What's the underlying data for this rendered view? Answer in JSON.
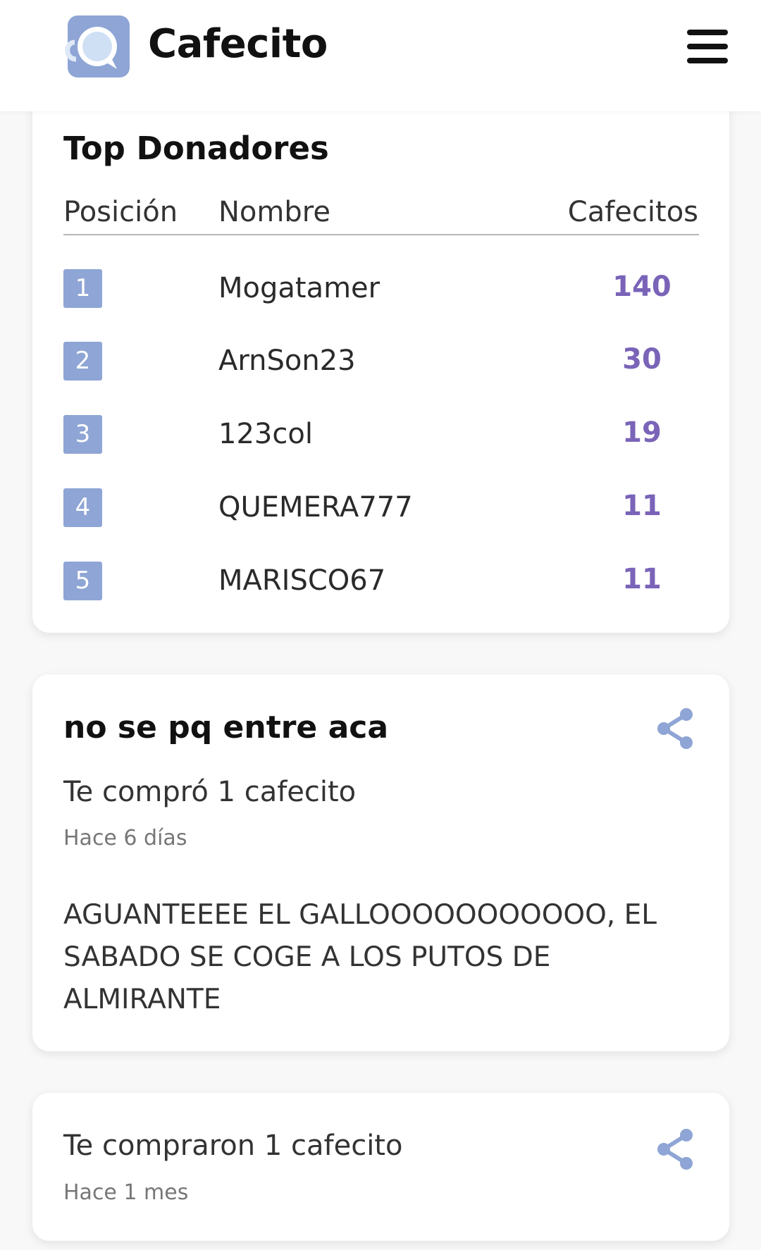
{
  "header": {
    "brand": "Cafecito",
    "logo_icon": "coffee-cup-logo-icon",
    "menu_icon": "hamburger-menu-icon"
  },
  "top_donors": {
    "title": "Top Donadores",
    "columns": [
      "Posición",
      "Nombre",
      "Cafecitos"
    ],
    "rows": [
      {
        "position": "1",
        "name": "Mogatamer",
        "count": "140"
      },
      {
        "position": "2",
        "name": "ArnSon23",
        "count": "30"
      },
      {
        "position": "3",
        "name": "123col",
        "count": "19"
      },
      {
        "position": "4",
        "name": "QUEMERA777",
        "count": "11"
      },
      {
        "position": "5",
        "name": "MARISCO67",
        "count": "11"
      }
    ]
  },
  "donations": [
    {
      "title": "no se pq entre aca",
      "bought": "Te compró 1 cafecito",
      "ago": "Hace 6 días",
      "message": "AGUANTEEEE EL GALLOOOOOOOOOOO, EL SABADO SE COGE A LOS PUTOS DE ALMIRANTE",
      "share_icon": "share-icon"
    },
    {
      "bought": "Te compraron 1 cafecito",
      "ago": "Hace 1 mes",
      "share_icon": "share-icon"
    }
  ],
  "colors": {
    "accent": "#7a64b8",
    "badge": "#8ea5d5",
    "logo": "#8ea5d5",
    "share": "#8ea5d5"
  }
}
